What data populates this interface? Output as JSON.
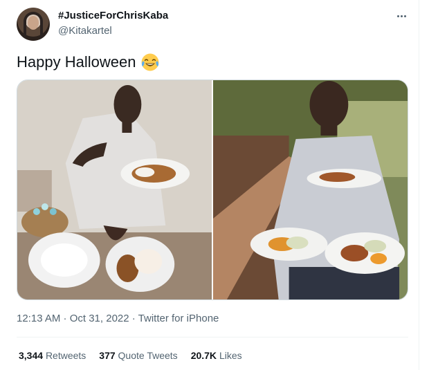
{
  "tweet": {
    "display_name": "#JusticeForChrisKaba",
    "handle": "@Kitakartel",
    "text": "Happy Halloween",
    "emoji": "face-with-tears-of-joy-icon",
    "timestamp": "12:13 AM · Oct 31, 2022 · Twitter for iPhone",
    "media": [
      "photo-woman-eating-plates",
      "photo-man-eating-plates-garden"
    ]
  },
  "stats": {
    "retweets_count": "3,344",
    "retweets_label": "Retweets",
    "quotes_count": "377",
    "quotes_label": "Quote Tweets",
    "likes_count": "20.7K",
    "likes_label": "Likes"
  },
  "colors": {
    "text_primary": "#0f1419",
    "text_secondary": "#536471",
    "border": "#cfd9de"
  }
}
